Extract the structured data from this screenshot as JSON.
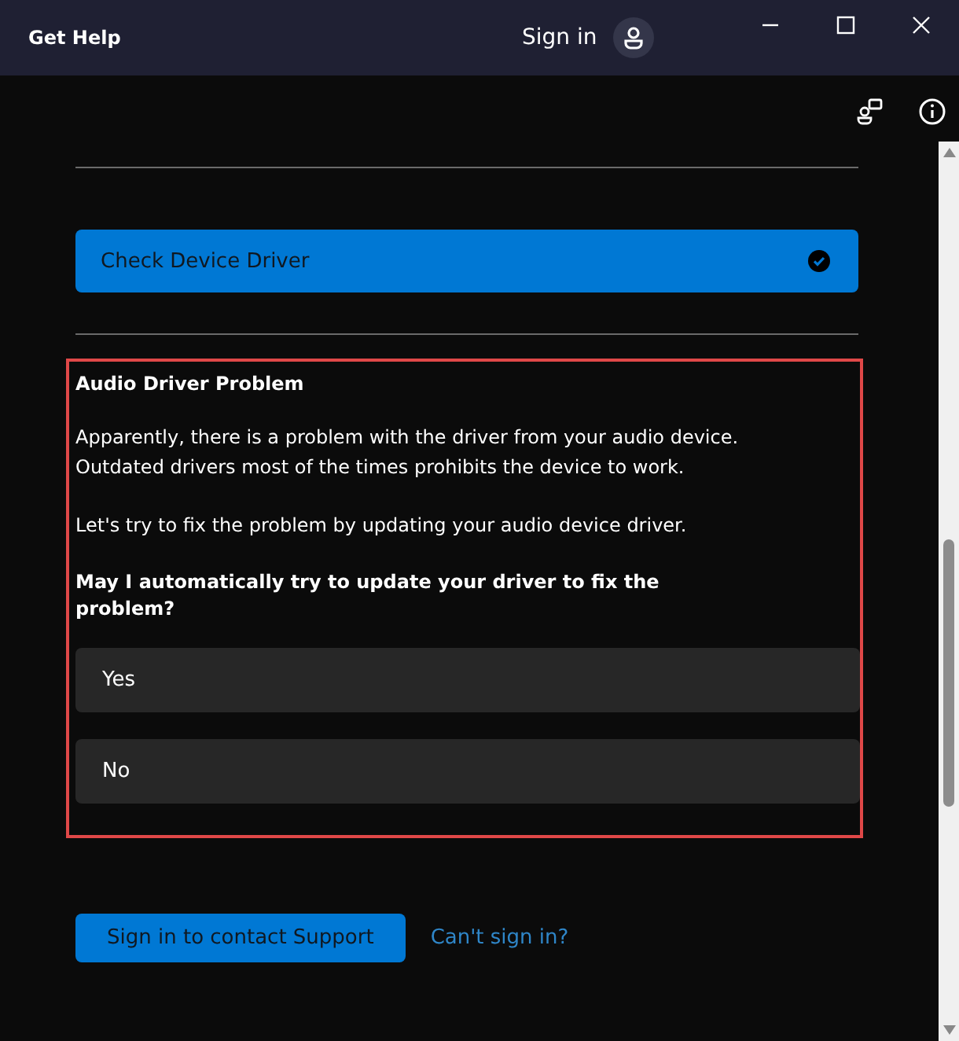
{
  "window": {
    "title": "Get Help",
    "sign_in": "Sign in"
  },
  "step": {
    "label": "Check Device Driver",
    "checked": true
  },
  "section": {
    "title": "Audio Driver Problem",
    "paragraphs": [
      "Apparently, there is a problem with the driver from your audio device. Outdated drivers most of the times prohibits the device to work.",
      "Let's try to fix the problem by updating your audio device driver."
    ],
    "question": "May I automatically try to update your driver to fix the problem?",
    "options": [
      {
        "label": "Yes"
      },
      {
        "label": "No"
      }
    ]
  },
  "footer": {
    "button": "Sign in to contact Support",
    "link": "Can't sign in?"
  }
}
